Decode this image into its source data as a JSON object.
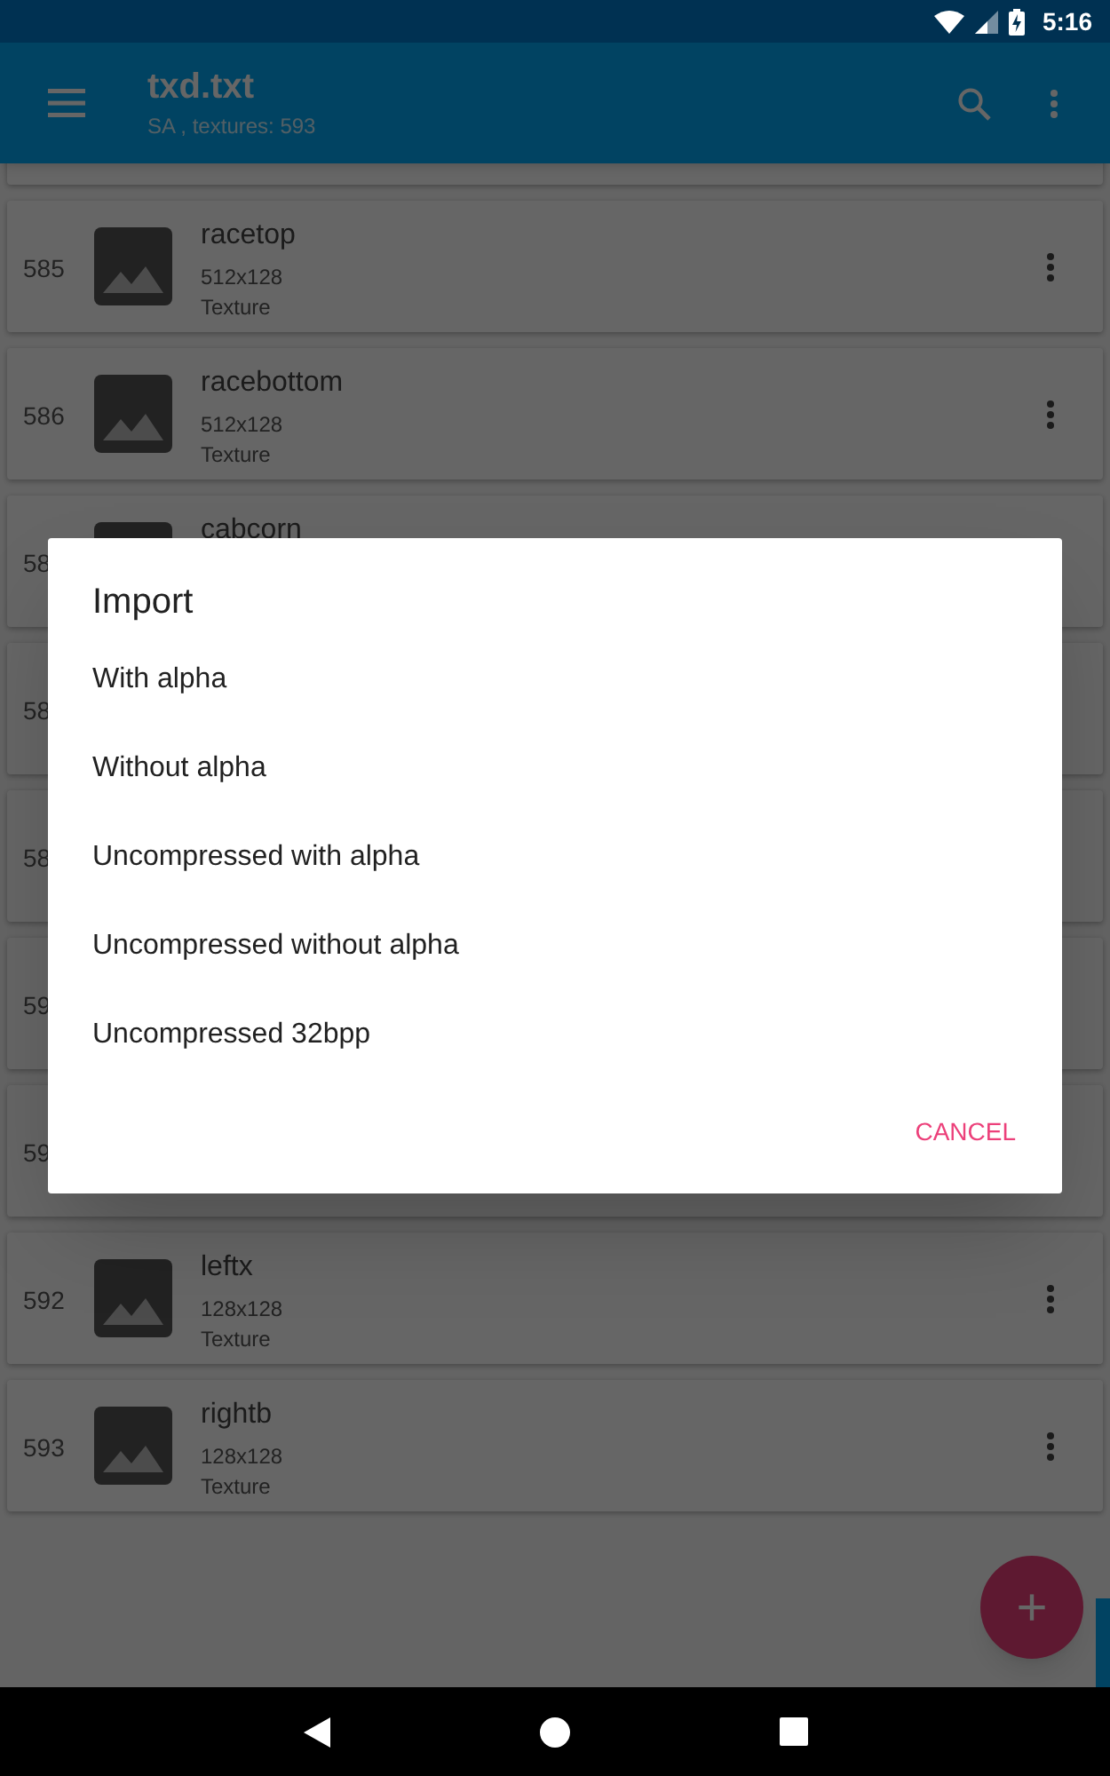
{
  "status_bar": {
    "time": "5:16"
  },
  "app_bar": {
    "title": "txd.txt",
    "subtitle": "SA , textures: 593"
  },
  "rows": [
    {
      "number": "585",
      "name": "racetop",
      "size": "512x128",
      "detail": "Texture"
    },
    {
      "number": "586",
      "name": "racebottom",
      "size": "512x128",
      "detail": "Texture"
    },
    {
      "number": "58",
      "name": "cabcorn"
    },
    {
      "number": "58"
    },
    {
      "number": "58"
    },
    {
      "number": "59"
    },
    {
      "number": "59"
    },
    {
      "number": "592",
      "name": "leftx",
      "size": "128x128",
      "detail": "Texture"
    },
    {
      "number": "593",
      "name": "rightb",
      "size": "128x128",
      "detail": "Texture"
    }
  ],
  "dialog": {
    "title": "Import",
    "options": [
      "With alpha",
      "Without alpha",
      "Uncompressed with alpha",
      "Uncompressed without alpha",
      "Uncompressed 32bpp"
    ],
    "button": "CANCEL"
  },
  "fab": {
    "label": "+"
  }
}
